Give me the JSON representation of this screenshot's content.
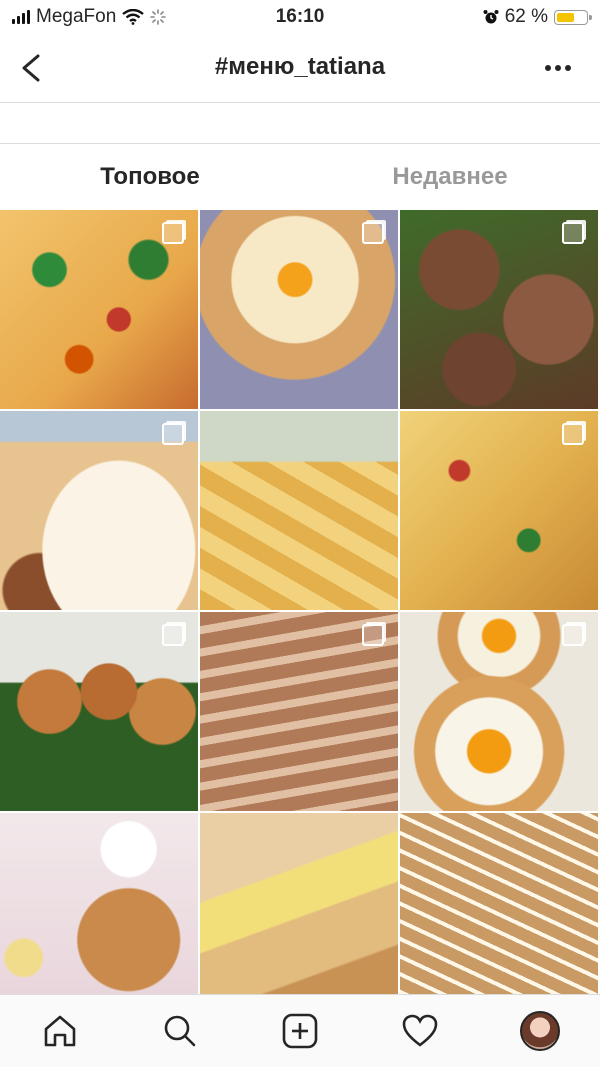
{
  "status_bar": {
    "carrier": "MegaFon",
    "time": "16:10",
    "battery_percent": "62 %",
    "battery_level": 0.62
  },
  "header": {
    "title": "#меню_tatiana",
    "back_icon": "chevron-left-icon",
    "more_icon": "more-dots-icon"
  },
  "tabs": [
    {
      "label": "Топовое",
      "active": true
    },
    {
      "label": "Недавнее",
      "active": false
    }
  ],
  "grid": {
    "posts": [
      {
        "name": "pizza-greens",
        "multi": true
      },
      {
        "name": "khachapuri-egg",
        "multi": true
      },
      {
        "name": "cutlets-dill",
        "multi": true
      },
      {
        "name": "flatbread-dill",
        "multi": true
      },
      {
        "name": "lavash-chips",
        "multi": false
      },
      {
        "name": "pizza-slices",
        "multi": true
      },
      {
        "name": "cutlets-plate",
        "multi": true
      },
      {
        "name": "pancake-stack",
        "multi": true
      },
      {
        "name": "egg-boats",
        "multi": true
      },
      {
        "name": "pancakes-banana",
        "multi": false
      },
      {
        "name": "lavash-rolls",
        "multi": false
      },
      {
        "name": "crepe-rolls",
        "multi": false
      }
    ]
  },
  "tab_bar": {
    "items": [
      "home-icon",
      "search-icon",
      "add-post-icon",
      "heart-icon",
      "profile-avatar"
    ]
  }
}
